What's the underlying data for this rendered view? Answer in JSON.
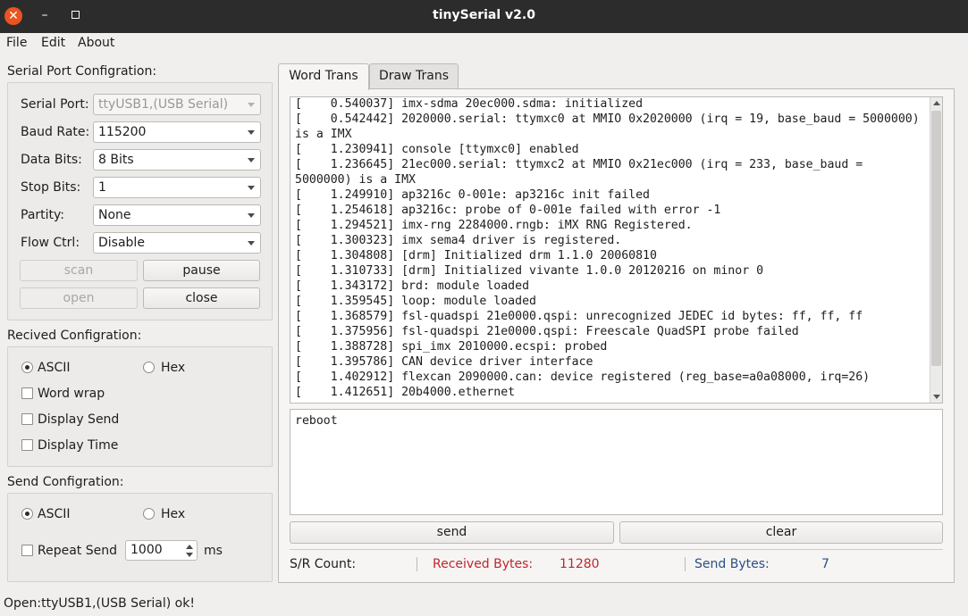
{
  "window": {
    "title": "tinySerial v2.0"
  },
  "menu": {
    "file": "File",
    "edit": "Edit",
    "about": "About"
  },
  "serial_config": {
    "title": "Serial Port Configration:",
    "port_label": "Serial Port:",
    "port_value": "ttyUSB1,(USB Serial)",
    "baud_label": "Baud Rate:",
    "baud_value": "115200",
    "data_bits_label": "Data Bits:",
    "data_bits_value": "8 Bits",
    "stop_bits_label": "Stop Bits:",
    "stop_bits_value": "1",
    "parity_label": "Partity:",
    "parity_value": "None",
    "flow_label": "Flow Ctrl:",
    "flow_value": "Disable",
    "scan": "scan",
    "pause": "pause",
    "open": "open",
    "close": "close"
  },
  "recv_config": {
    "title": "Recived Configration:",
    "ascii": "ASCII",
    "hex": "Hex",
    "word_wrap": "Word wrap",
    "display_send": "Display Send",
    "display_time": "Display Time"
  },
  "send_config": {
    "title": "Send Configration:",
    "ascii": "ASCII",
    "hex": "Hex",
    "repeat_send": "Repeat Send",
    "repeat_interval": "1000",
    "unit": "ms"
  },
  "status": {
    "message": "Open:ttyUSB1,(USB Serial) ok!"
  },
  "tabs": [
    {
      "label": "Word Trans"
    },
    {
      "label": "Draw Trans"
    }
  ],
  "log": {
    "lines": [
      "[    0.540037] imx-sdma 20ec000.sdma: initialized",
      "[    0.542442] 2020000.serial: ttymxc0 at MMIO 0x2020000 (irq = 19, base_baud = 5000000)",
      "is a IMX",
      "[    1.230941] console [ttymxc0] enabled",
      "[    1.236645] 21ec000.serial: ttymxc2 at MMIO 0x21ec000 (irq = 233, base_baud =",
      "5000000) is a IMX",
      "[    1.249910] ap3216c 0-001e: ap3216c init failed",
      "[    1.254618] ap3216c: probe of 0-001e failed with error -1",
      "[    1.294521] imx-rng 2284000.rngb: iMX RNG Registered.",
      "[    1.300323] imx sema4 driver is registered.",
      "[    1.304808] [drm] Initialized drm 1.1.0 20060810",
      "[    1.310733] [drm] Initialized vivante 1.0.0 20120216 on minor 0",
      "[    1.343172] brd: module loaded",
      "[    1.359545] loop: module loaded",
      "[    1.368579] fsl-quadspi 21e0000.qspi: unrecognized JEDEC id bytes: ff, ff, ff",
      "[    1.375956] fsl-quadspi 21e0000.qspi: Freescale QuadSPI probe failed",
      "[    1.388728] spi_imx 2010000.ecspi: probed",
      "[    1.395786] CAN device driver interface",
      "[    1.402912] flexcan 2090000.can: device registered (reg_base=a0a08000, irq=26)",
      "[    1.412651] 20b4000.ethernet"
    ]
  },
  "send_input": {
    "value": "reboot"
  },
  "actions": {
    "send": "send",
    "clear": "clear"
  },
  "counts": {
    "label": "S/R Count:",
    "received_label": "Received Bytes:",
    "received_value": "11280",
    "send_label": "Send Bytes:",
    "send_value": "7"
  },
  "colors": {
    "received": "#c0262b",
    "send": "#2a4f86",
    "accent": "#e95420"
  }
}
